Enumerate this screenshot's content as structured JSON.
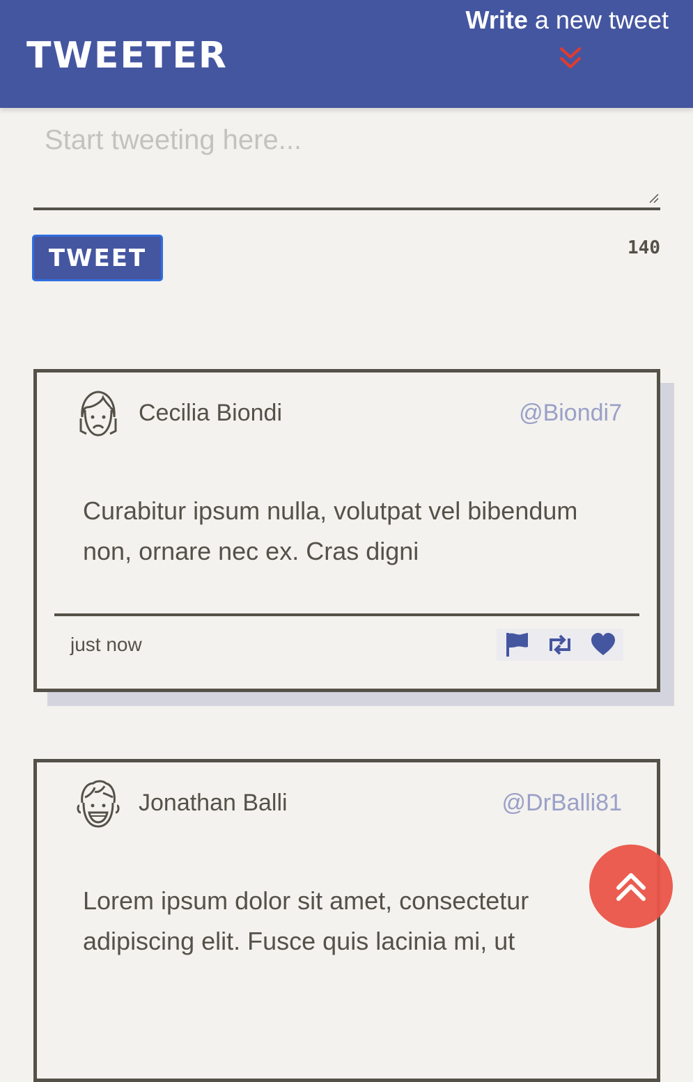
{
  "nav": {
    "brand": "TWEETER",
    "compose_toggle": {
      "strong": "Write",
      "rest": "a new tweet"
    }
  },
  "composer": {
    "placeholder": "Start tweeting here...",
    "value": "",
    "submit_label": "TWEET",
    "char_counter": "140"
  },
  "tweets": [
    {
      "name": "Cecilia Biondi",
      "handle": "@Biondi7",
      "avatar_icon": "sad-woman-face-icon",
      "content": "Curabitur ipsum nulla, volutpat vel bibendum non, ornare nec ex. Cras digni",
      "timestamp": "just now",
      "actions": [
        "flag-icon",
        "retweet-icon",
        "heart-icon"
      ]
    },
    {
      "name": "Jonathan Balli",
      "handle": "@DrBalli81",
      "avatar_icon": "smiling-man-face-icon",
      "content": "Lorem ipsum dolor sit amet, consectetur adipiscing elit. Fusce quis lacinia mi, ut"
    }
  ],
  "scroll_top_icon": "double-chevron-up-icon",
  "colors": {
    "nav_bg": "#4556a0",
    "page_bg": "#f4f2ee",
    "text": "#545149",
    "handle": "#9aa0c8",
    "accent_red": "#ea5648",
    "card_shadow": "#d3d4de"
  }
}
